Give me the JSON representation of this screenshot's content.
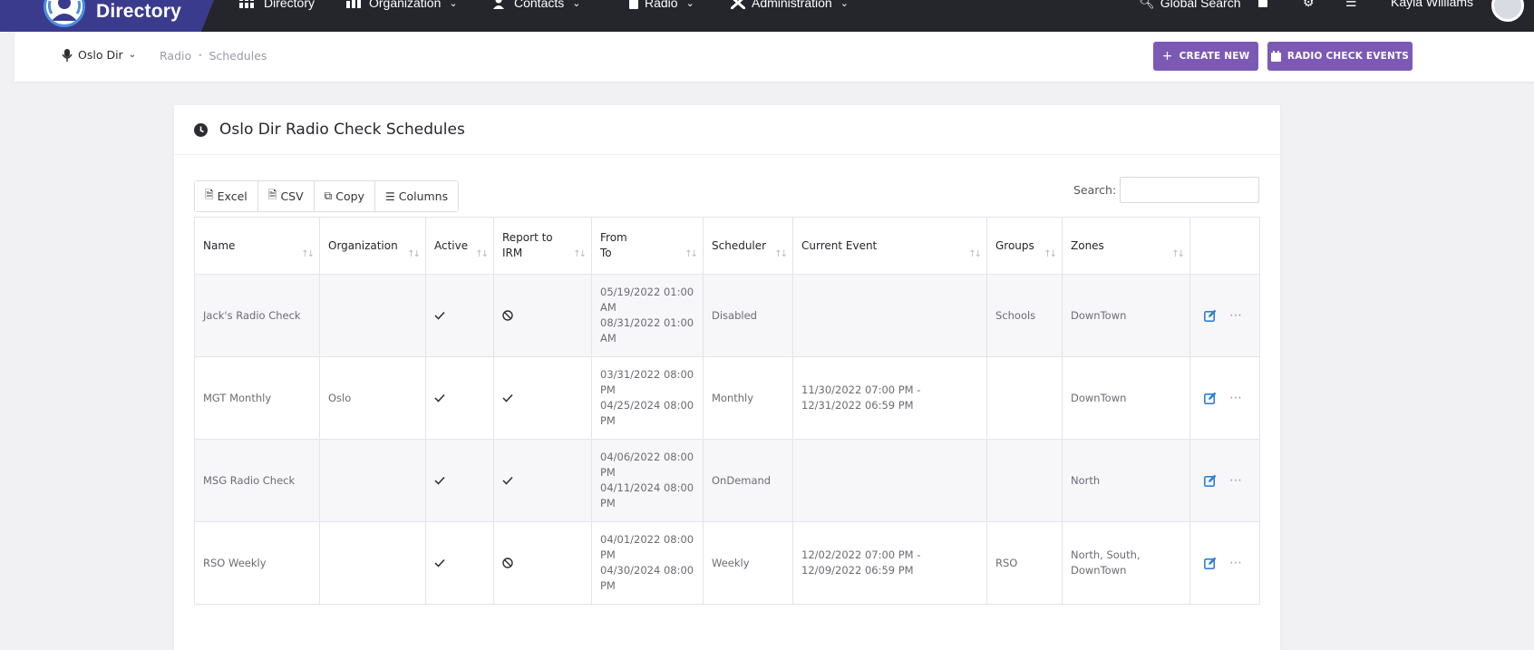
{
  "brand": {
    "name": "Directory"
  },
  "nav": {
    "items": [
      {
        "label": "Directory",
        "icon": "grid-icon"
      },
      {
        "label": "Organization",
        "icon": "chart-icon"
      },
      {
        "label": "Contacts",
        "icon": "contacts-icon"
      },
      {
        "label": "Radio",
        "icon": "radio-icon"
      },
      {
        "label": "Administration",
        "icon": "tools-icon"
      }
    ],
    "global_search": "Global Search",
    "user_name": "Kayla Williams"
  },
  "subheader": {
    "org_label": "Oslo Dir",
    "breadcrumb": [
      "Radio",
      "Schedules"
    ],
    "create_label": "CREATE NEW",
    "events_label": "RADIO CHECK EVENTS"
  },
  "card": {
    "title": "Oslo Dir Radio Check Schedules",
    "toolbar": {
      "excel": "Excel",
      "csv": "CSV",
      "copy": "Copy",
      "columns": "Columns"
    },
    "search_label": "Search:",
    "search_value": ""
  },
  "table": {
    "headers": [
      {
        "line1": "Name",
        "line2": ""
      },
      {
        "line1": "Organization",
        "line2": ""
      },
      {
        "line1": "Active",
        "line2": ""
      },
      {
        "line1": "Report to",
        "line2": "IRM"
      },
      {
        "line1": "From",
        "line2": "To"
      },
      {
        "line1": "Scheduler",
        "line2": ""
      },
      {
        "line1": "Current Event",
        "line2": ""
      },
      {
        "line1": "Groups",
        "line2": ""
      },
      {
        "line1": "Zones",
        "line2": ""
      }
    ],
    "rows": [
      {
        "name": "Jack's Radio Check",
        "org": "",
        "active": "check",
        "irm": "ban",
        "from": "05/19/2022 01:00 AM",
        "to": "08/31/2022 01:00 AM",
        "scheduler": "Disabled",
        "event": "",
        "groups": "Schools",
        "zones": "DownTown"
      },
      {
        "name": "MGT Monthly",
        "org": "Oslo",
        "active": "check",
        "irm": "check",
        "from": "03/31/2022 08:00 PM",
        "to": "04/25/2024 08:00 PM",
        "scheduler": "Monthly",
        "event": "11/30/2022 07:00 PM - 12/31/2022 06:59 PM",
        "groups": "",
        "zones": "DownTown"
      },
      {
        "name": "MSG Radio Check",
        "org": "",
        "active": "check",
        "irm": "check",
        "from": "04/06/2022 08:00 PM",
        "to": "04/11/2024 08:00 PM",
        "scheduler": "OnDemand",
        "event": "",
        "groups": "",
        "zones": "North"
      },
      {
        "name": "RSO Weekly",
        "org": "",
        "active": "check",
        "irm": "ban",
        "from": "04/01/2022 08:00 PM",
        "to": "04/30/2024 08:00 PM",
        "scheduler": "Weekly",
        "event": "12/02/2022 07:00 PM - 12/09/2022 06:59 PM",
        "groups": "RSO",
        "zones": "North, South, DownTown"
      }
    ]
  },
  "colors": {
    "nav_bg": "#25252c",
    "brand_bg": "#3b3b8e",
    "accent": "#7d59b6",
    "edit_icon": "#2f7fd8"
  }
}
